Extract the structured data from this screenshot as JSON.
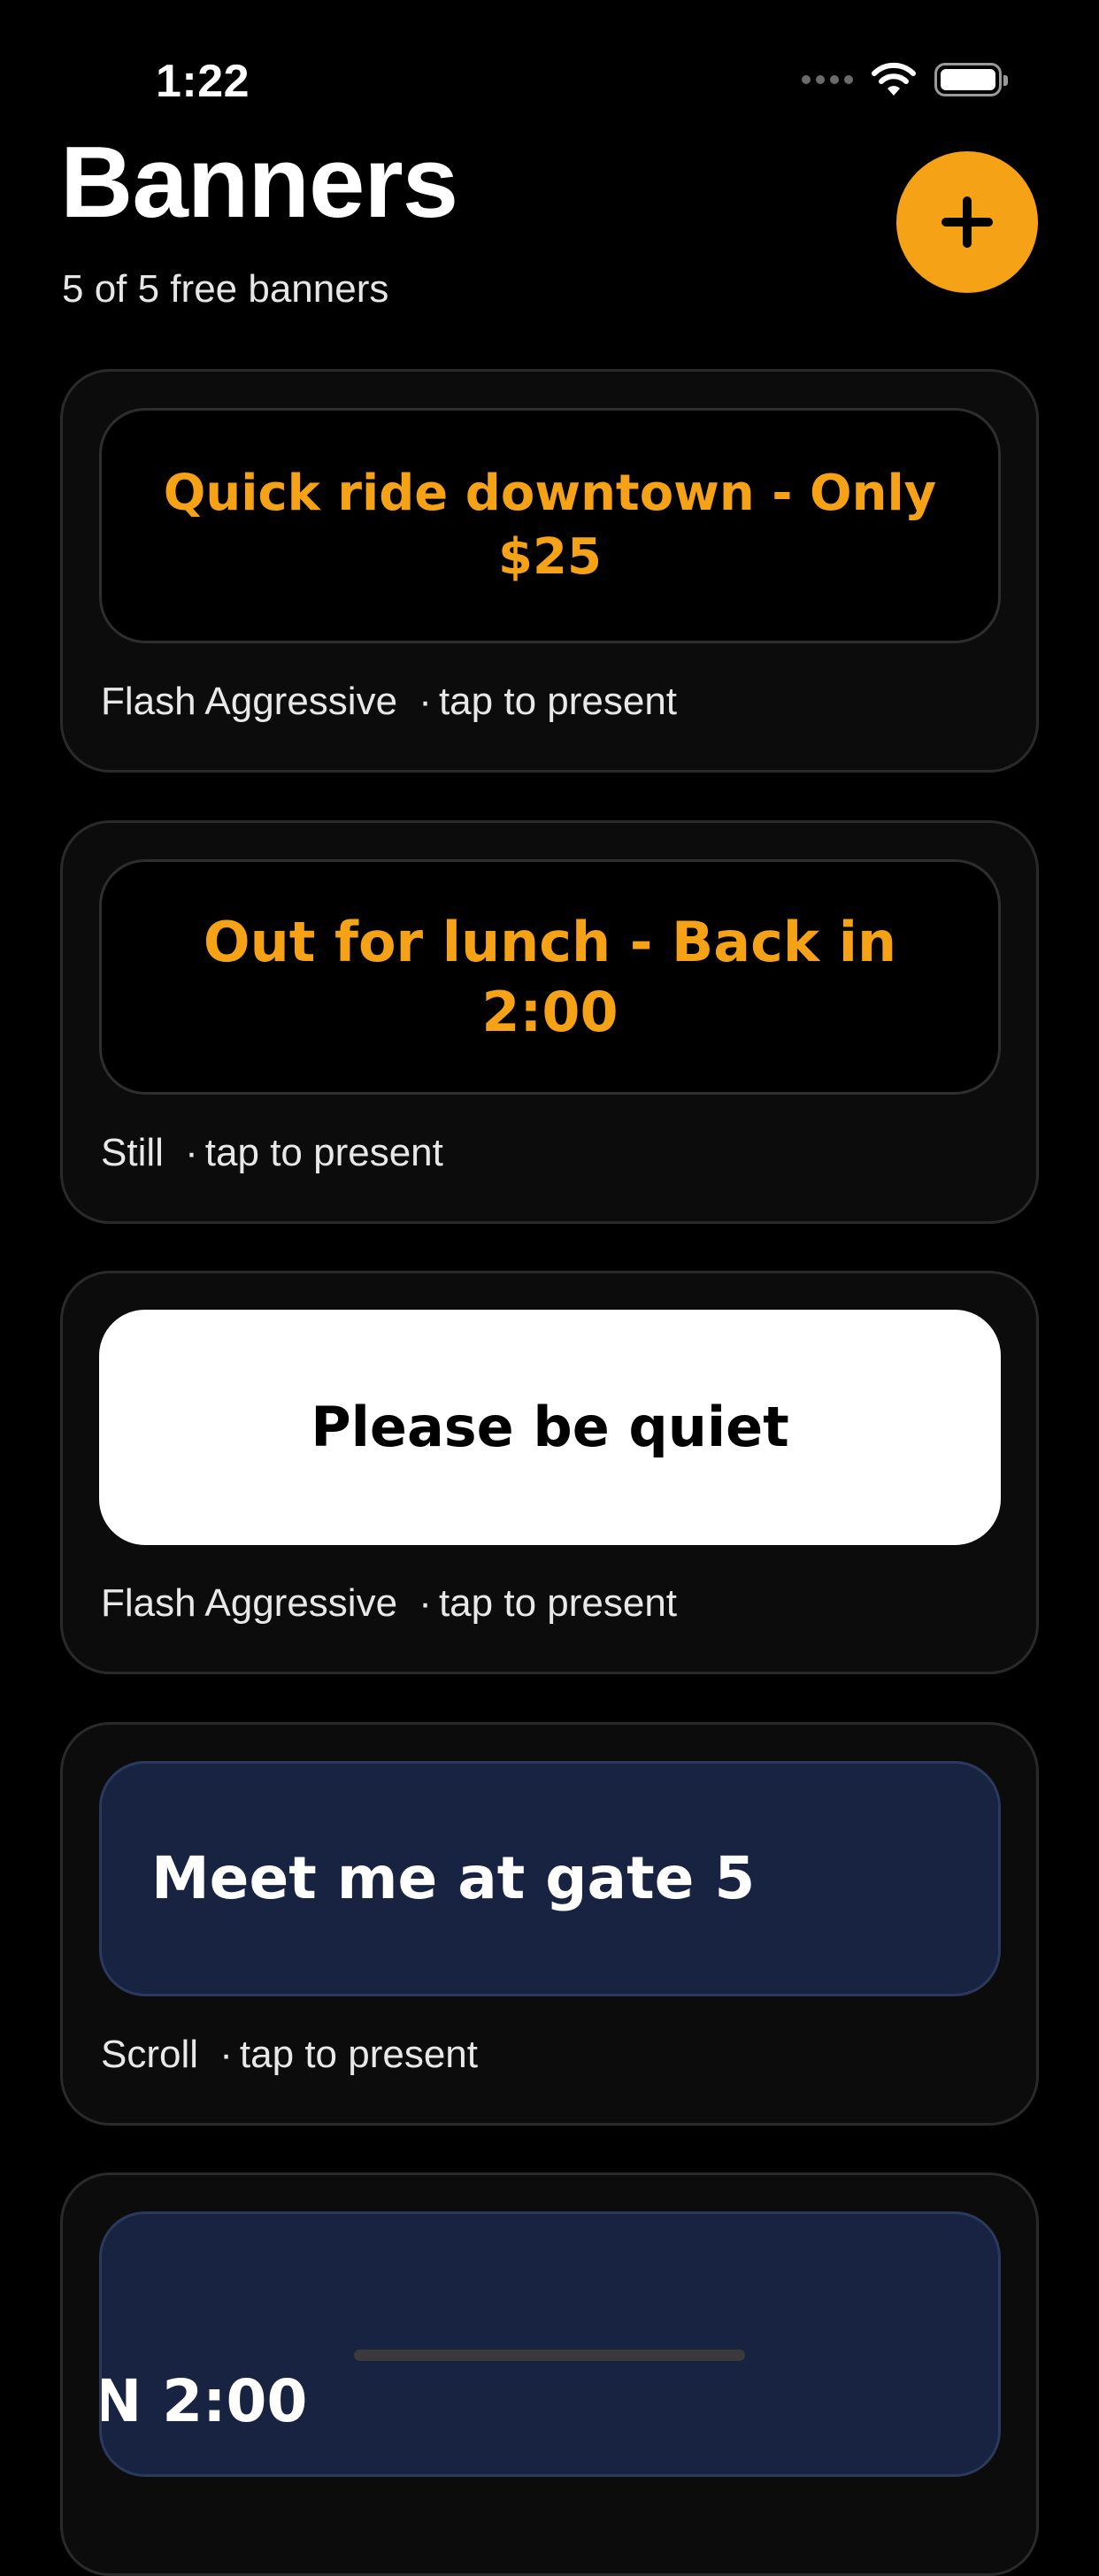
{
  "status_bar": {
    "time": "1:22",
    "icons": [
      "signal-dots-icon",
      "wifi-icon",
      "battery-icon"
    ]
  },
  "header": {
    "title": "Banners",
    "subtitle": "5 of 5 free banners",
    "add_icon": "plus-icon"
  },
  "colors": {
    "accent": "#f5a216",
    "background": "#000000",
    "card": "#0c0c0c",
    "navy": "#172340",
    "white": "#ffffff"
  },
  "banners": [
    {
      "text": "Quick ride downtown - Only $25",
      "style": "dark",
      "modes": [
        "Flash",
        "Aggressive"
      ],
      "hint": "tap to present"
    },
    {
      "text": "Out for lunch - Back in 2:00",
      "style": "dark",
      "modes": [
        "Still"
      ],
      "hint": "tap to present"
    },
    {
      "text": "Please be quiet",
      "style": "light",
      "modes": [
        "Flash",
        "Aggressive"
      ],
      "hint": "tap to present"
    },
    {
      "text": "Meet me at gate 5",
      "style": "navy",
      "modes": [
        "Scroll"
      ],
      "hint": "tap to present"
    },
    {
      "text": "N 2:00",
      "style": "navy"
    }
  ],
  "separator": "·"
}
